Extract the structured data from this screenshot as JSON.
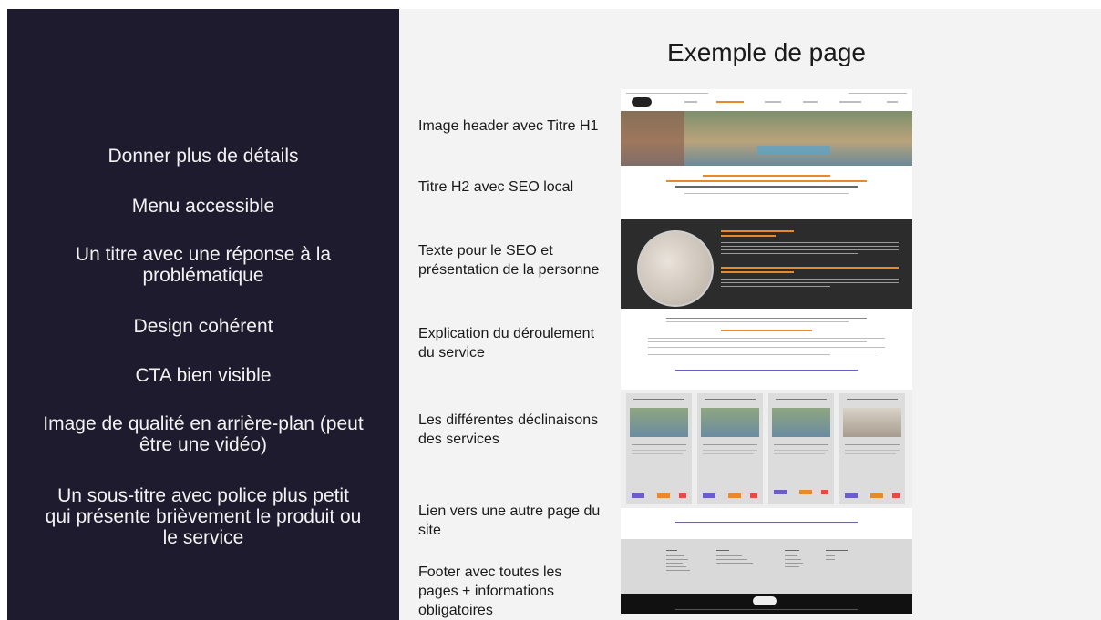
{
  "left_panel": {
    "bullets": [
      "Donner plus de détails",
      "Menu accessible",
      "Un titre avec une réponse à la problématique",
      "Design cohérent",
      "CTA bien visible",
      "Image de qualité en arrière-plan (peut être une vidéo)",
      "Un sous-titre avec police plus petit qui présente brièvement le produit ou le service"
    ]
  },
  "right_panel": {
    "title": "Exemple de page",
    "labels": [
      "Image header avec Titre H1",
      "Titre H2 avec SEO local",
      "Texte pour le SEO et présentation de la personne",
      "Explication du déroulement du service",
      "Les différentes déclinaisons des services",
      "Lien vers une autre page du site",
      "Footer avec toutes les pages + informations obligatoires"
    ]
  },
  "colors": {
    "left_bg": "#1e1b2e",
    "right_bg": "#f3f3f3",
    "accent_orange": "#e98a2a",
    "accent_purple": "#6b5fc7"
  }
}
